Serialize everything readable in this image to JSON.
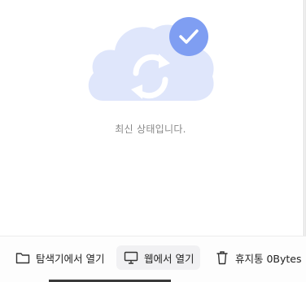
{
  "status": {
    "message": "최신 상태입니다.",
    "illustration_icon": "cloud-sync-check",
    "cloud_color": "#dfe6fb",
    "badge_color": "#7f9ef2"
  },
  "footer": {
    "open_explorer_label": "탐색기에서 열기",
    "open_explorer_icon": "folder-icon",
    "open_web_label": "웹에서 열기",
    "open_web_icon": "monitor-icon",
    "trash_label": "휴지통 0Bytes",
    "trash_icon": "trash-icon"
  }
}
